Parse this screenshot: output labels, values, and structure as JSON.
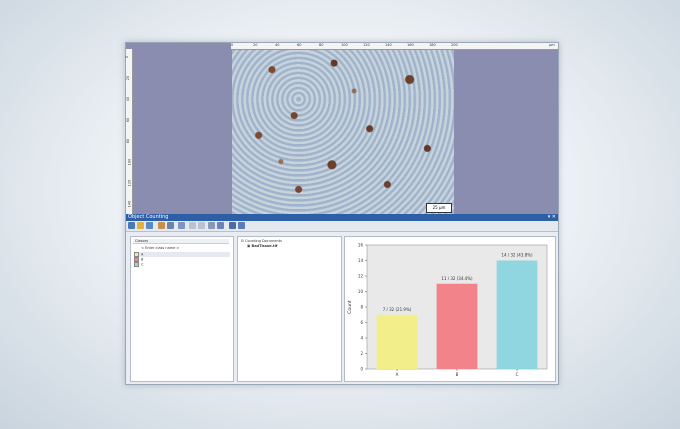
{
  "viewer": {
    "hruler_ticks": [
      "0",
      "20",
      "40",
      "60",
      "80",
      "100",
      "120",
      "140",
      "160",
      "180",
      "200",
      "μm"
    ],
    "vruler_ticks": [
      "0",
      "20",
      "40",
      "60",
      "80",
      "100",
      "120",
      "140"
    ],
    "scale_label": "25 μm"
  },
  "panel": {
    "title": "Object Counting",
    "buttons": "▾ ✕"
  },
  "classes": {
    "header": "Classes",
    "placeholder": "< Enter class name >",
    "items": [
      {
        "label": "A",
        "color": "#f0ef8a"
      },
      {
        "label": "B",
        "color": "#f2838a"
      },
      {
        "label": "C",
        "color": "#8fd6e0"
      }
    ]
  },
  "documents": {
    "root": "Counting Documents",
    "file": "BadTissue.tif"
  },
  "chart_data": {
    "type": "bar",
    "categories": [
      "A",
      "B",
      "C"
    ],
    "values": [
      7,
      11,
      14
    ],
    "data_labels": [
      "7 / 32 (21.9%)",
      "11 / 32 (34.4%)",
      "14 / 32 (43.8%)"
    ],
    "colors": [
      "#f2ef8a",
      "#f2838a",
      "#8fd6e0"
    ],
    "ylabel": "Count",
    "xlabel": "",
    "ylim": [
      0,
      16
    ],
    "yticks": [
      "0",
      "2",
      "4",
      "6",
      "8",
      "10",
      "12",
      "14",
      "16"
    ]
  }
}
